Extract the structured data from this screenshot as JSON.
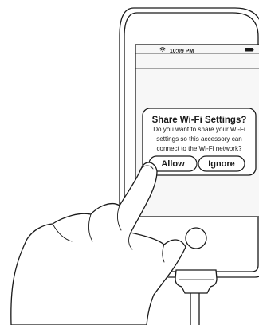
{
  "status_bar": {
    "time": "10:09 PM",
    "wifi_icon": "wifi-icon",
    "battery_icon": "battery-icon"
  },
  "alert": {
    "title": "Share Wi-Fi Settings?",
    "message_lines": [
      "Do you want to share your Wi-Fi",
      "settings so this accessory can",
      "connect to the Wi-Fi network?"
    ],
    "allow_label": "Allow",
    "ignore_label": "Ignore"
  },
  "colors": {
    "line": "#1a1a1a",
    "screen": "#f7f7f7",
    "alert_fill": "#ffffff",
    "background": "#ffffff"
  }
}
